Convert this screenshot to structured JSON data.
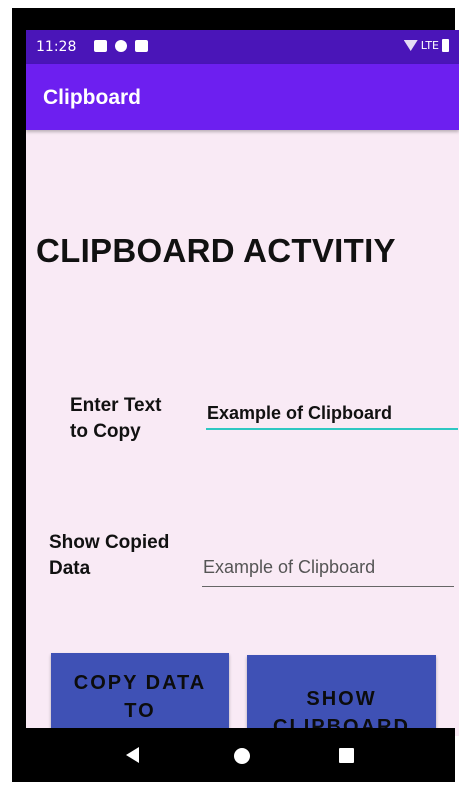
{
  "status_bar": {
    "time": "11:28",
    "network": "LTE",
    "icons": [
      "message-icon",
      "pocket-icon",
      "sd-card-icon",
      "wifi-icon",
      "battery-icon"
    ]
  },
  "app_bar": {
    "title": "Clipboard",
    "color": "#6d1ff0"
  },
  "main": {
    "heading": "CLIPBOARD ACTVITIY",
    "enter_label": "Enter Text to Copy",
    "enter_value": "Example of Clipboard",
    "show_label": "Show Copied Data",
    "copied_value": "Example of Clipboard"
  },
  "buttons": {
    "copy_label": "COPY DATA TO CLIPBOARD",
    "show_label": "SHOW CLIPBOARD",
    "color": "#3f51b5"
  },
  "nav_bar": {
    "icons": [
      "back-icon",
      "home-icon",
      "recents-icon"
    ]
  },
  "colors": {
    "background": "#f9eaf5",
    "status_bar": "#4a15b8",
    "accent_underline": "#2ec7c2"
  }
}
